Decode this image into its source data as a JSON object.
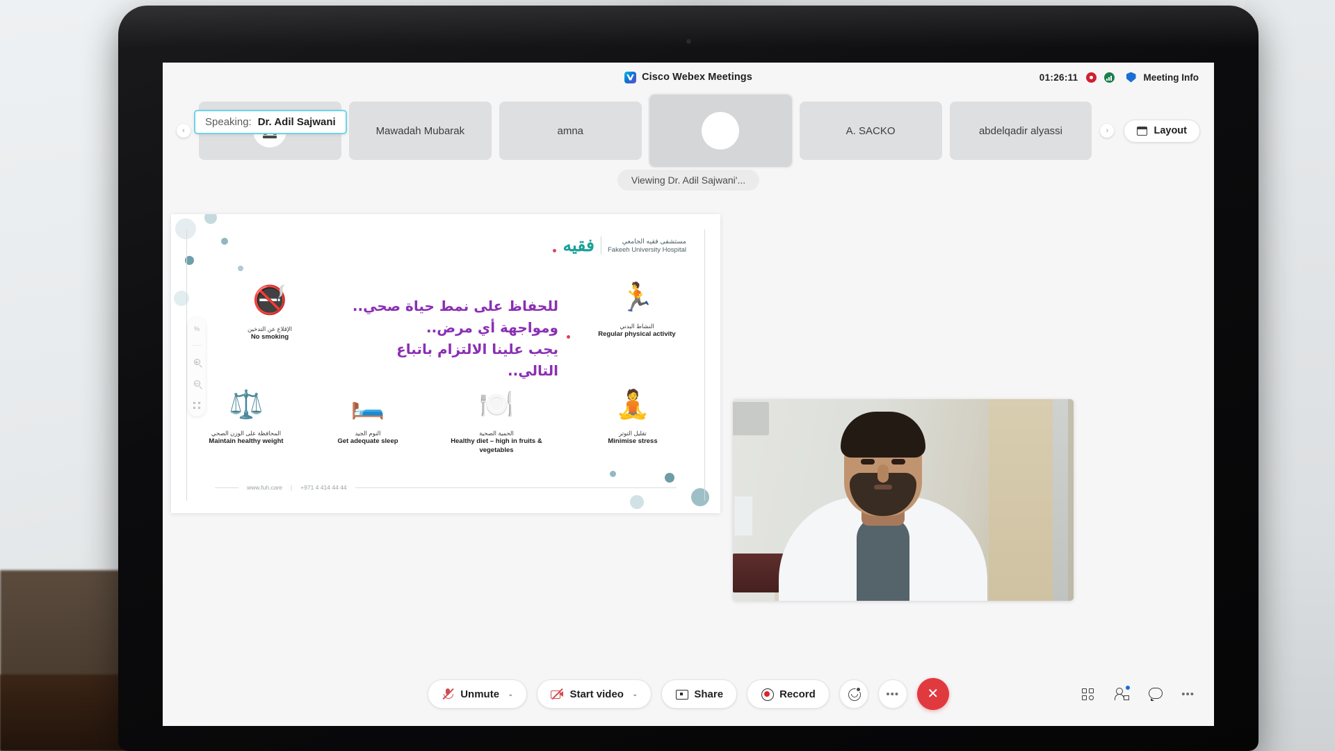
{
  "app": {
    "title": "Cisco Webex Meetings",
    "logo_icon": "webex-logo-icon",
    "timer": "01:26:11",
    "recording_icon": "record-indicator-icon",
    "signal_icon": "network-signal-icon",
    "meeting_info_icon": "meeting-info-icon",
    "meeting_info_label": "Meeting Info"
  },
  "filmstrip": {
    "prev_arrow": "‹",
    "next_arrow": "›",
    "speaking_label": "Speaking:",
    "speaking_name": "Dr. Adil Sajwani",
    "tiles": [
      {
        "name": "",
        "kind": "logo-avatar"
      },
      {
        "name": "Mawadah Mubarak",
        "kind": "name"
      },
      {
        "name": "amna",
        "kind": "name"
      },
      {
        "name": "",
        "kind": "blank-avatar"
      },
      {
        "name": "A. SACKO",
        "kind": "name"
      },
      {
        "name": "abdelqadir alyassi",
        "kind": "name"
      }
    ],
    "layout_label": "Layout",
    "layout_icon": "layout-grid-icon"
  },
  "stage": {
    "viewing_text": "Viewing Dr. Adil Sajwani'...",
    "share_tools": [
      {
        "icon": "zoom-percent-icon",
        "label": "%"
      },
      {
        "icon": "zoom-in-icon",
        "label": ""
      },
      {
        "icon": "zoom-out-icon",
        "label": ""
      },
      {
        "icon": "fit-to-screen-icon",
        "label": ""
      }
    ]
  },
  "slide": {
    "logo_arabic": "فقيه",
    "logo_name_ar": "مستشفى فقيه الجامعي",
    "logo_name_en": "Fakeeh University Hospital",
    "headline_lines": [
      "للحفاظ على نمط حياة صحي..",
      "ومواجهة أي مرض..",
      "يجب علينا الالتزام باتباع التالي.."
    ],
    "items": [
      {
        "glyph": "🚭",
        "ar": "الإقلاع عن التدخين",
        "en": "No smoking",
        "icon": "no-smoking-icon"
      },
      {
        "glyph": "🏃",
        "ar": "النشاط البدني",
        "en": "Regular physical activity",
        "icon": "running-icon"
      },
      {
        "glyph": "⚖️",
        "ar": "المحافظة على الوزن الصحي",
        "en": "Maintain healthy weight",
        "icon": "scale-icon"
      },
      {
        "glyph": "🛏️",
        "ar": "النوم الجيد",
        "en": "Get adequate sleep",
        "icon": "bed-icon"
      },
      {
        "glyph": "🍽️",
        "ar": "الحمية الصحية",
        "en": "Healthy diet – high in fruits & vegetables",
        "icon": "healthy-diet-icon"
      },
      {
        "glyph": "🧘",
        "ar": "تقليل التوتر",
        "en": "Minimise stress",
        "icon": "minimise-stress-icon"
      }
    ],
    "footer_website": "www.fuh.care",
    "footer_sep": "|",
    "footer_phone": "+971 4 414 44 44"
  },
  "controls": {
    "unmute": {
      "label": "Unmute",
      "icon": "mic-muted-icon",
      "caret": "⌄"
    },
    "start_video": {
      "label": "Start video",
      "icon": "camera-off-icon",
      "caret": "⌄"
    },
    "share": {
      "label": "Share",
      "icon": "share-screen-icon"
    },
    "record": {
      "label": "Record",
      "icon": "record-icon"
    },
    "reactions": {
      "icon": "reactions-smiley-icon"
    },
    "more": {
      "icon": "more-options-icon",
      "label": "•••"
    },
    "leave": {
      "icon": "leave-meeting-icon",
      "label": "✕"
    },
    "right_icons": [
      {
        "icon": "apps-grid-icon"
      },
      {
        "icon": "participants-icon",
        "badge": true
      },
      {
        "icon": "chat-bubble-icon"
      },
      {
        "icon": "more-options-icon",
        "label": "•••"
      }
    ]
  },
  "colors": {
    "accent_cyan": "#6fd3e8",
    "record_red": "#cf2030",
    "leave_red": "#e03a3f",
    "headline_purple": "#8a2fb5",
    "logo_teal": "#1aa09a",
    "badge_blue": "#1a6fd4"
  }
}
